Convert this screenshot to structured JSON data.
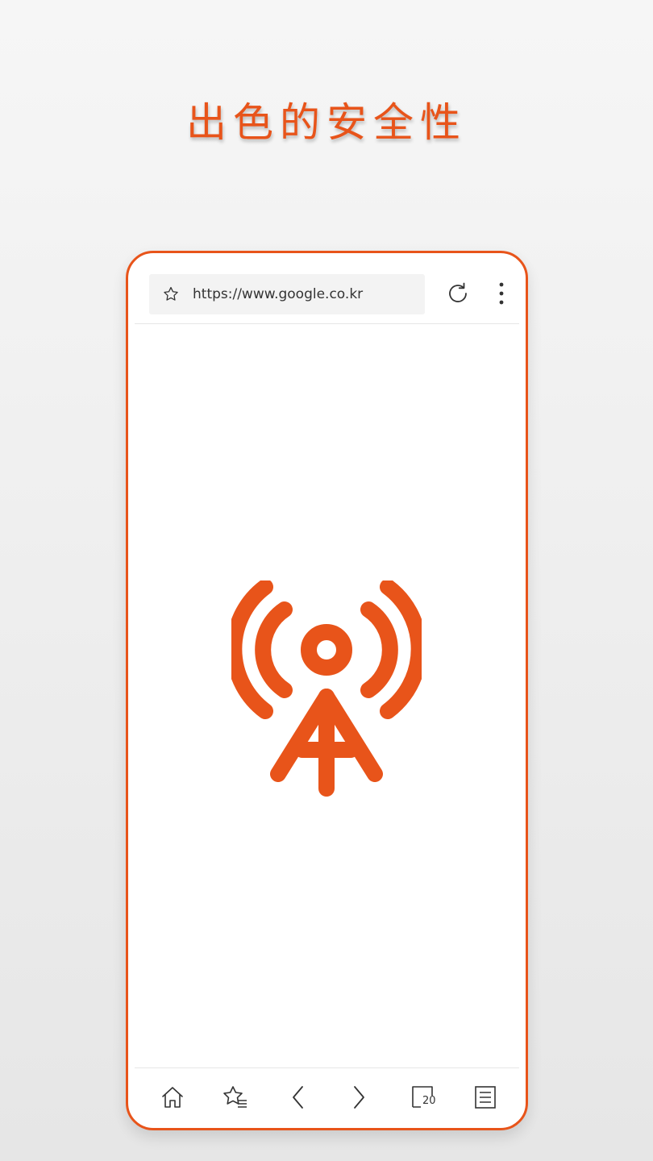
{
  "headline": "出色的安全性",
  "browser": {
    "url": "https://www.google.co.kr",
    "icons": {
      "bookmark": "star-icon",
      "reload": "reload-icon",
      "menu": "more-vertical-icon",
      "content": "antenna-broadcast-icon"
    }
  },
  "bottom_nav": {
    "items": [
      {
        "name": "home",
        "icon": "home-icon"
      },
      {
        "name": "bookmarks",
        "icon": "bookmarks-list-icon"
      },
      {
        "name": "back",
        "icon": "chevron-left-icon"
      },
      {
        "name": "forward",
        "icon": "chevron-right-icon"
      },
      {
        "name": "tabs",
        "icon": "tabs-icon"
      },
      {
        "name": "menu",
        "icon": "list-menu-icon"
      }
    ],
    "tab_count": "20"
  },
  "colors": {
    "accent": "#e8541a",
    "icon": "#333333",
    "background": "#f0f0f0"
  }
}
